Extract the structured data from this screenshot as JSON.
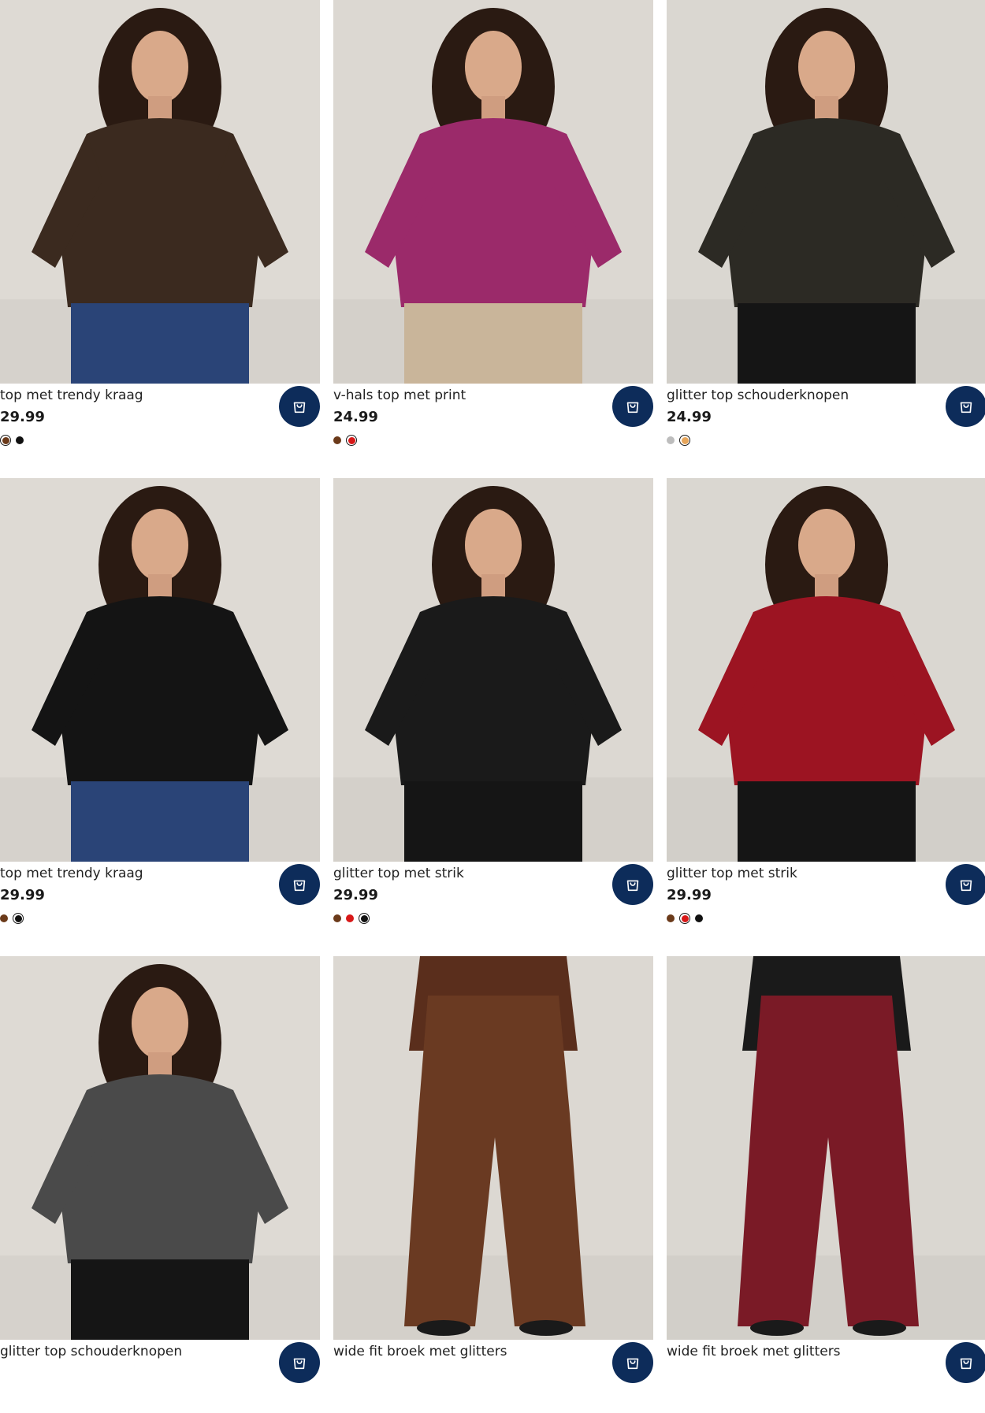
{
  "products": [
    {
      "name": "top met trendy kraag",
      "price": "29.99",
      "photo_alt": "top met trendy kraag",
      "colors": [
        "#6b3a1a",
        "#111111"
      ],
      "selected_color": 0,
      "bg": "#dedad4",
      "garment": "#3b2a1f",
      "bottom": "#2a4477",
      "cart_icon": "shopping-bag-icon"
    },
    {
      "name": "v-hals top met print",
      "price": "24.99",
      "photo_alt": "v-hals top met print",
      "colors": [
        "#6b3a1a",
        "#d81818"
      ],
      "selected_color": 1,
      "bg": "#dcd8d2",
      "garment": "#9b2a6a",
      "bottom": "#c9b59a",
      "cart_icon": "shopping-bag-icon"
    },
    {
      "name": "glitter top schouderknopen",
      "price": "24.99",
      "photo_alt": "glitter top schouderknopen",
      "colors": [
        "#bdbdbd",
        "#e6a55a"
      ],
      "selected_color": 1,
      "bg": "#dad7d1",
      "garment": "#2c2a24",
      "bottom": "#151515",
      "cart_icon": "shopping-bag-icon"
    },
    {
      "name": "top met trendy kraag",
      "price": "29.99",
      "photo_alt": "top met trendy kraag",
      "colors": [
        "#6b3a1a",
        "#111111"
      ],
      "selected_color": 1,
      "bg": "#dedad4",
      "garment": "#141414",
      "bottom": "#2a4477",
      "cart_icon": "shopping-bag-icon"
    },
    {
      "name": "glitter top met strik",
      "price": "29.99",
      "photo_alt": "glitter top met strik",
      "colors": [
        "#6b3a1a",
        "#d81818",
        "#111111"
      ],
      "selected_color": 2,
      "bg": "#dcd8d2",
      "garment": "#1a1a1a",
      "bottom": "#151515",
      "cart_icon": "shopping-bag-icon"
    },
    {
      "name": "glitter top met strik",
      "price": "29.99",
      "photo_alt": "glitter top met strik",
      "colors": [
        "#6b3a1a",
        "#d81818",
        "#111111"
      ],
      "selected_color": 1,
      "bg": "#dad7d1",
      "garment": "#9c1422",
      "bottom": "#151515",
      "cart_icon": "shopping-bag-icon"
    },
    {
      "name": "glitter top schouderknopen",
      "price": "",
      "photo_alt": "glitter top schouderknopen",
      "colors": [],
      "selected_color": -1,
      "bg": "#dedad4",
      "garment": "#4a4a4a",
      "bottom": "#151515",
      "cart_icon": "shopping-bag-icon"
    },
    {
      "name": "wide fit broek met glitters",
      "price": "",
      "photo_alt": "wide fit broek met glitters",
      "colors": [],
      "selected_color": -1,
      "bg": "#dcd8d2",
      "garment": "#5a2e1c",
      "bottom": "#6a3a22",
      "cart_icon": "shopping-bag-icon"
    },
    {
      "name": "wide fit broek met glitters",
      "price": "",
      "photo_alt": "wide fit broek met glitters",
      "colors": [],
      "selected_color": -1,
      "bg": "#dad7d1",
      "garment": "#1a1a1a",
      "bottom": "#7a1a26",
      "cart_icon": "shopping-bag-icon"
    }
  ],
  "brand_colors": {
    "cart_button": "#0d2c5a"
  }
}
